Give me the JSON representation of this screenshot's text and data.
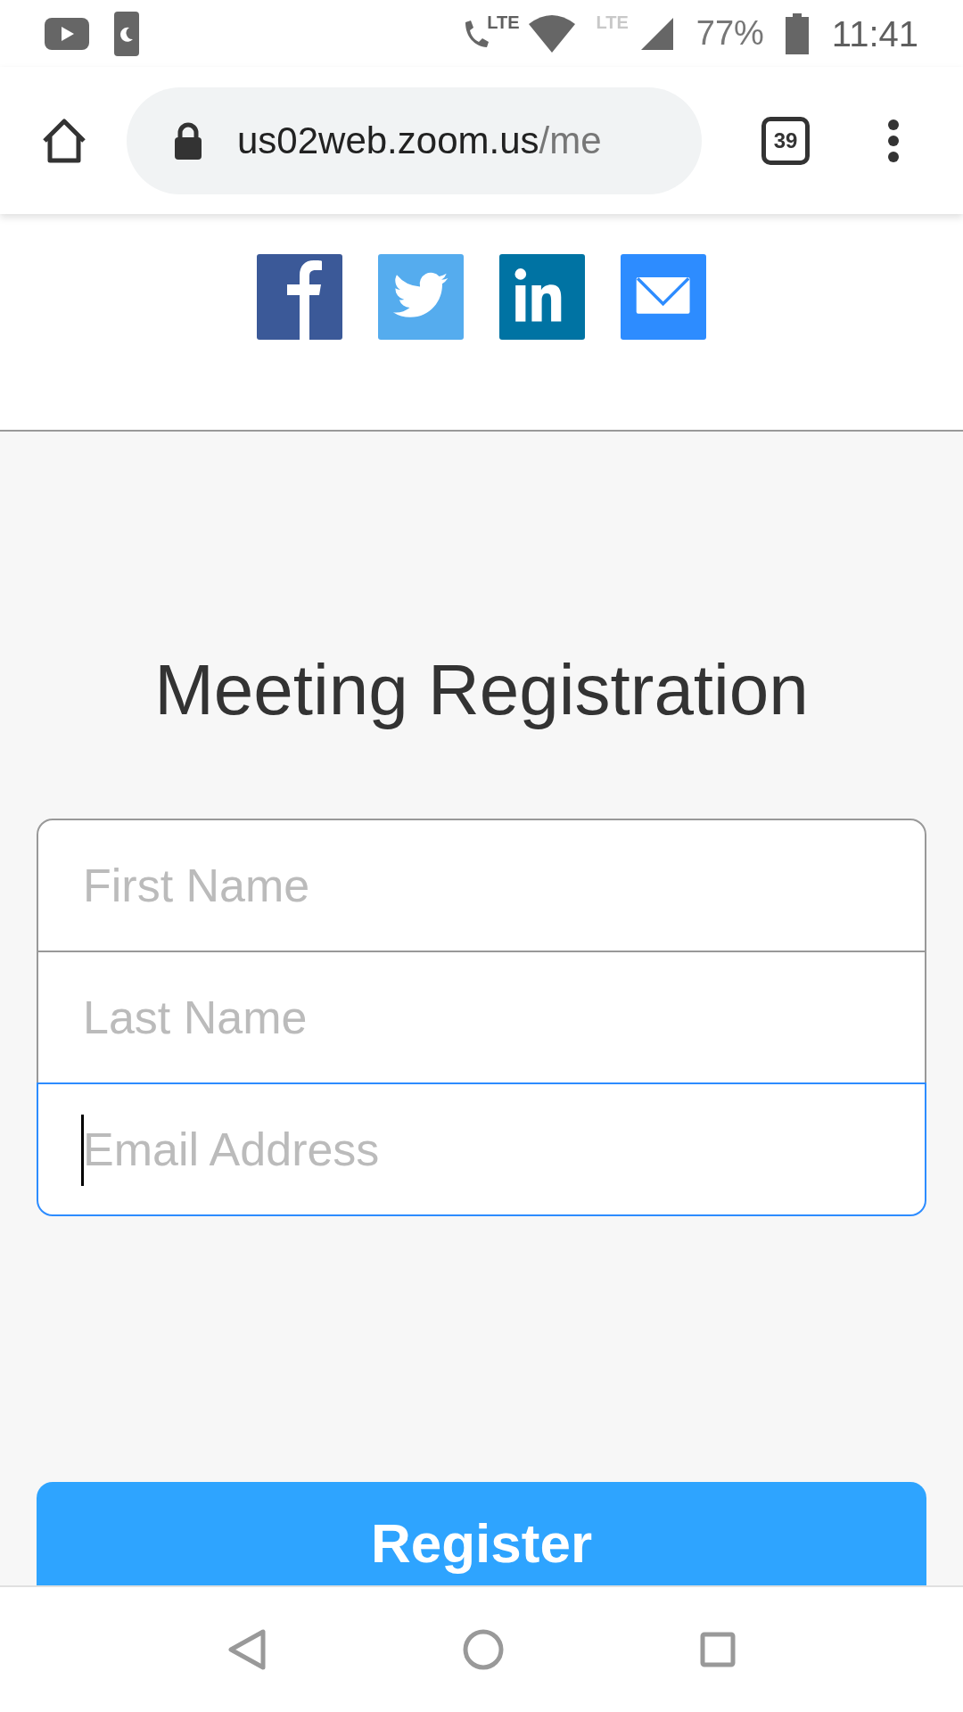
{
  "status_bar": {
    "call_network": "LTE",
    "data_network": "LTE",
    "battery": "77%",
    "time": "11:41"
  },
  "browser": {
    "url_host": "us02web.zoom.us",
    "url_path": "/me",
    "tab_count": "39"
  },
  "share_buttons": [
    {
      "kind": "facebook",
      "color": "#3b5998"
    },
    {
      "kind": "twitter",
      "color": "#55acee"
    },
    {
      "kind": "linkedin",
      "color": "#0073a3"
    },
    {
      "kind": "email",
      "color": "#2d8cff"
    }
  ],
  "title": "Meeting Registration",
  "fields": [
    {
      "placeholder": "First Name",
      "focused": false
    },
    {
      "placeholder": "Last Name",
      "focused": false
    },
    {
      "placeholder": "Email Address",
      "focused": true
    }
  ],
  "register_button": "Register"
}
